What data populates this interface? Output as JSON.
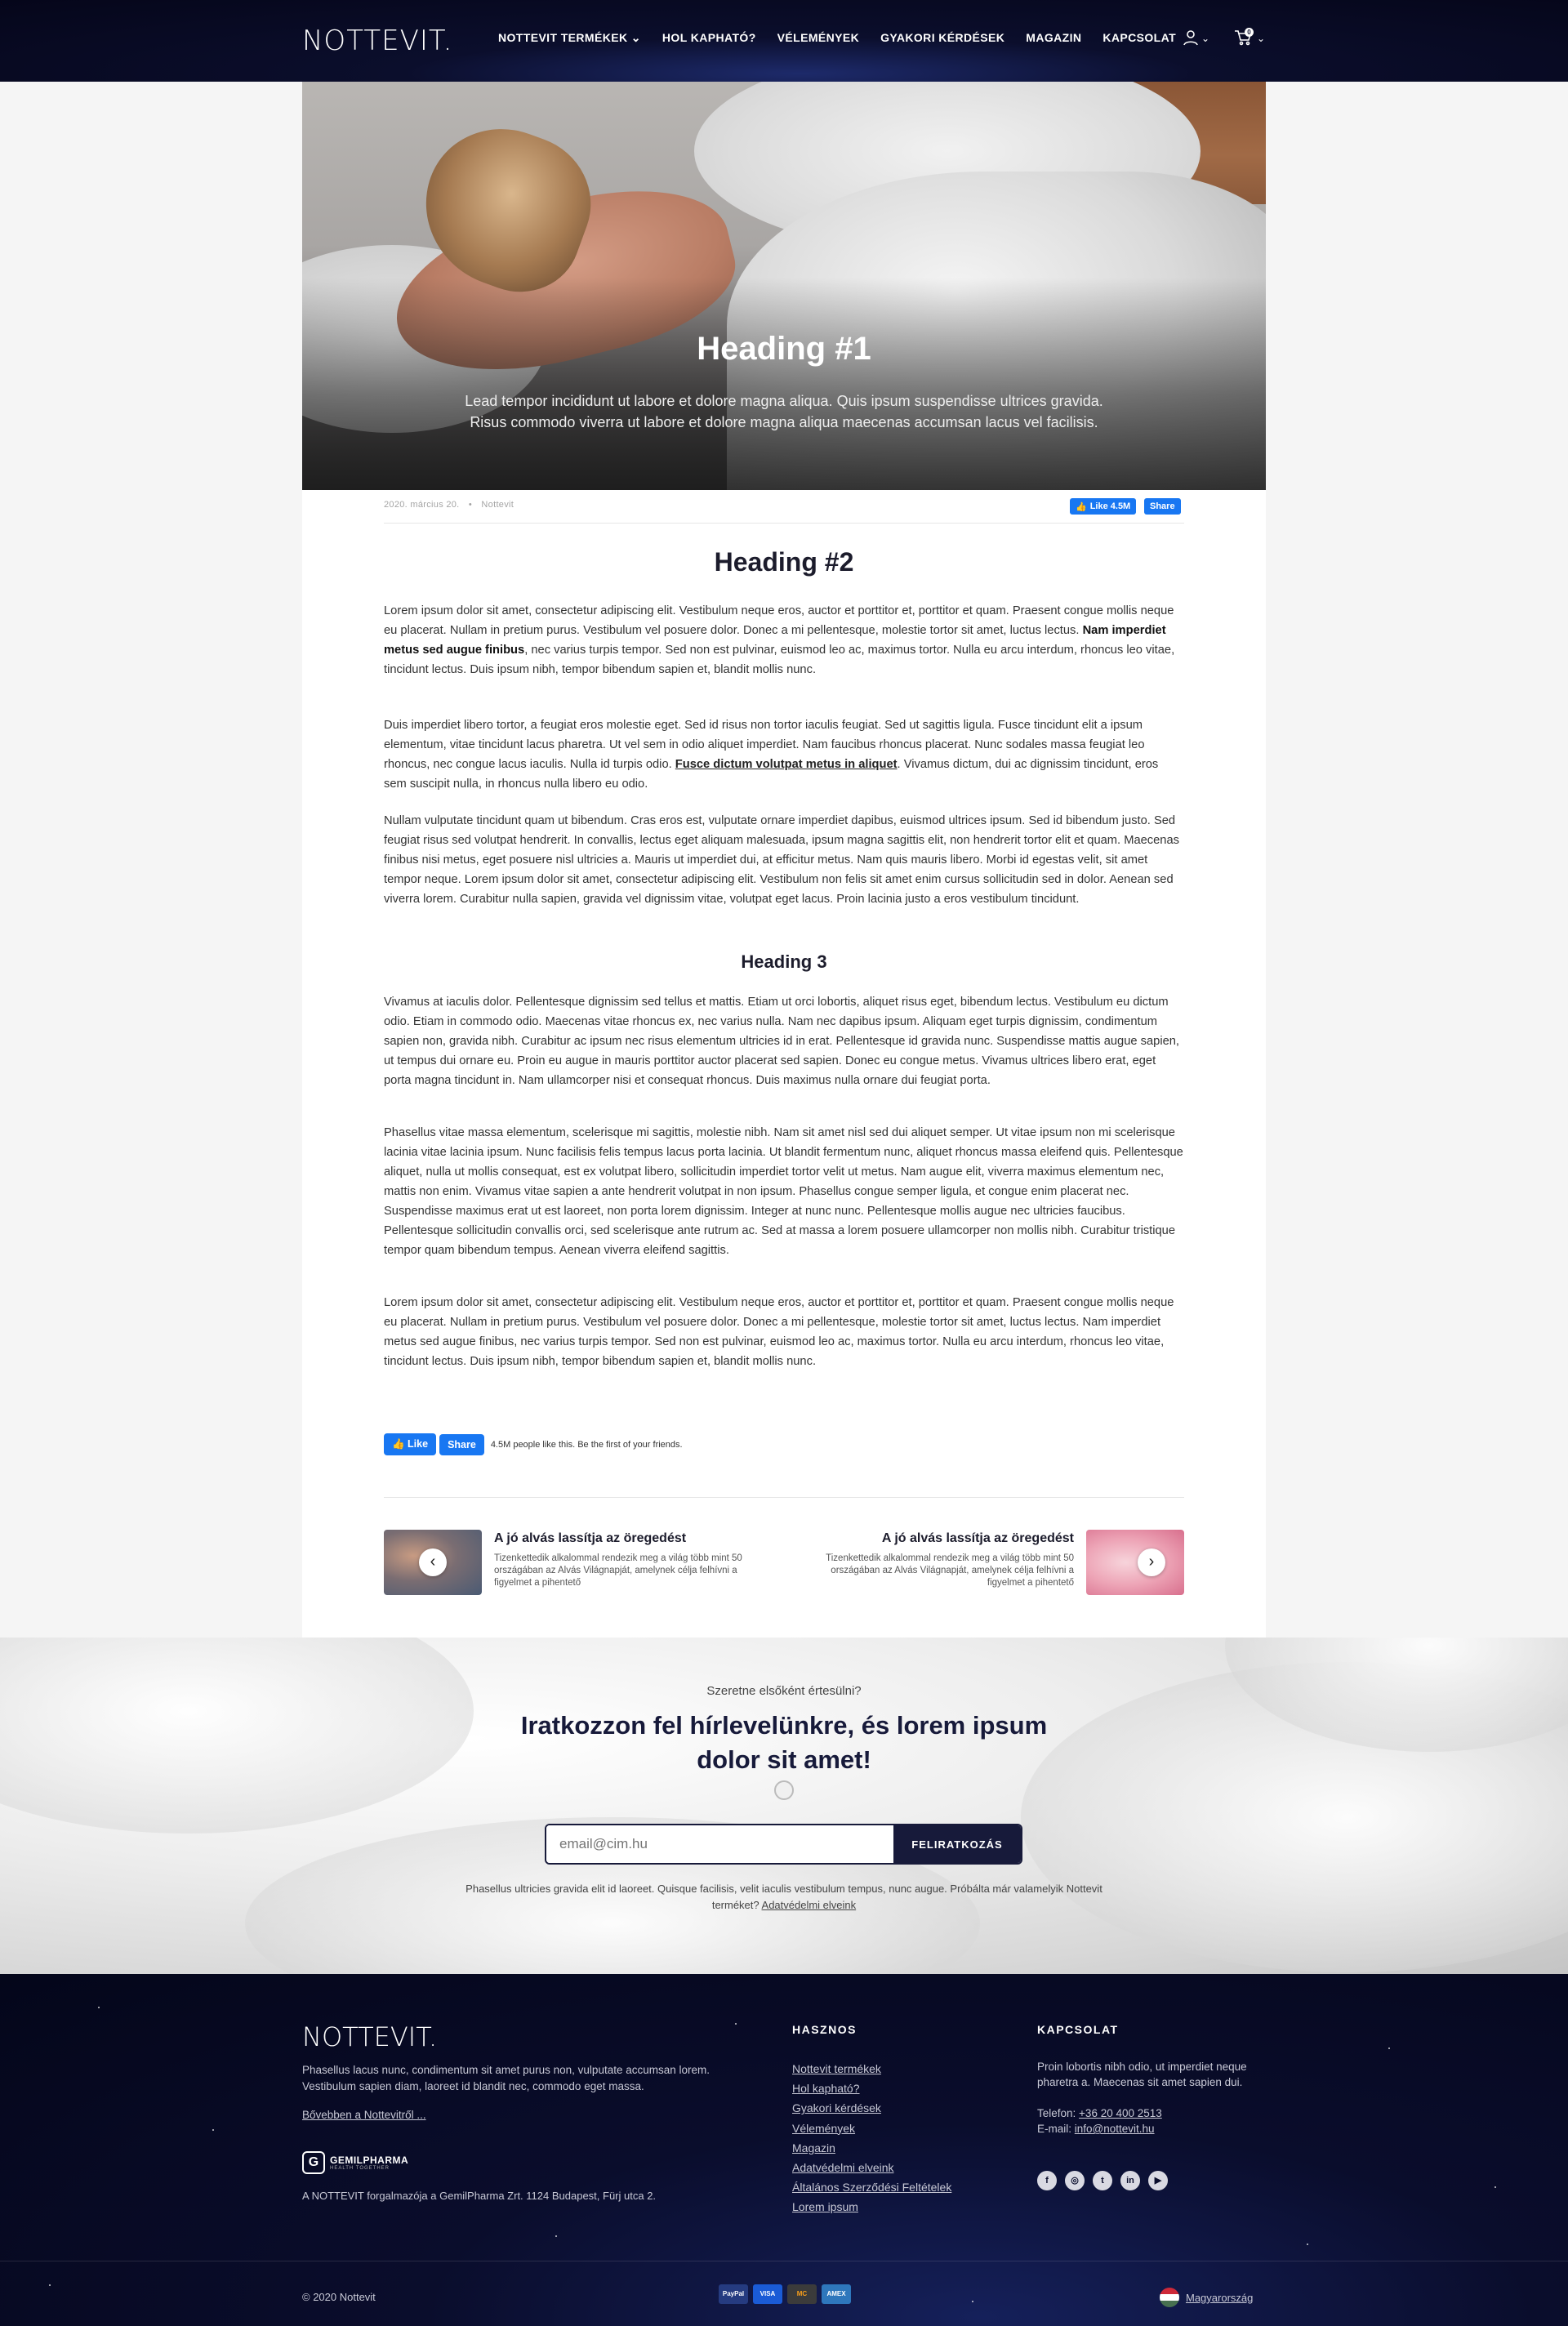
{
  "header": {
    "logo": "NOTTEVIT.",
    "nav": [
      "NOTTEVIT TERMÉKEK",
      "HOL KAPHATÓ?",
      "VÉLEMÉNYEK",
      "GYAKORI KÉRDÉSEK",
      "MAGAZIN",
      "KAPCSOLAT"
    ],
    "cart_count": "0",
    "icons": [
      "chevron-down-icon",
      "user-icon",
      "cart-icon"
    ]
  },
  "hero": {
    "title": "Heading #1",
    "lead": "Lead tempor incididunt ut labore et dolore magna aliqua. Quis ipsum suspendisse ultrices gravida. Risus commodo viverra ut labore et dolore magna aliqua maecenas accumsan lacus vel facilisis."
  },
  "meta": {
    "date": "2020. március 20.",
    "separator": "•",
    "author": "Nottevit",
    "fb_like": "Like 4.5M",
    "fb_share": "Share"
  },
  "article": {
    "heading2": "Heading #2",
    "p1_a": "Lorem ipsum dolor sit amet, consectetur adipiscing elit. Vestibulum neque eros, auctor et porttitor et, porttitor et quam. Praesent congue mollis neque eu placerat. Nullam in pretium purus. Vestibulum vel posuere dolor. Donec a mi pellentesque, molestie tortor sit amet, luctus lectus. ",
    "p1_bold": "Nam imperdiet metus sed augue finibus",
    "p1_b": ", nec varius turpis tempor. Sed non est pulvinar, euismod leo ac, maximus tortor. Nulla eu arcu interdum, rhoncus leo vitae, tincidunt lectus. Duis ipsum nibh, tempor bibendum sapien et, blandit mollis nunc.",
    "p2_a": "Duis imperdiet libero tortor, a feugiat eros molestie eget. Sed id risus non tortor iaculis feugiat. Sed ut sagittis ligula. Fusce tincidunt elit a ipsum elementum, vitae tincidunt lacus pharetra. Ut vel sem in odio aliquet imperdiet. Nam faucibus rhoncus placerat. Nunc sodales massa feugiat leo rhoncus, nec congue lacus iaculis. Nulla id turpis odio. ",
    "p2_link": "Fusce dictum volutpat metus in aliquet",
    "p2_b": ". Vivamus dictum, dui ac dignissim tincidunt, eros sem suscipit nulla, in rhoncus nulla libero eu odio.",
    "p3": "Nullam vulputate tincidunt quam ut bibendum. Cras eros est, vulputate ornare imperdiet dapibus, euismod ultrices ipsum. Sed id bibendum justo. Sed feugiat risus sed volutpat hendrerit. In convallis, lectus eget aliquam malesuada, ipsum magna sagittis elit, non hendrerit tortor elit et quam. Maecenas finibus nisi metus, eget posuere nisl ultricies a. Mauris ut imperdiet dui, at efficitur metus. Nam quis mauris libero. Morbi id egestas velit, sit amet tempor neque. Lorem ipsum dolor sit amet, consectetur adipiscing elit. Vestibulum non felis sit amet enim cursus sollicitudin sed in dolor. Aenean sed viverra lorem. Curabitur nulla sapien, gravida vel dignissim vitae, volutpat eget lacus. Proin lacinia justo a eros vestibulum tincidunt.",
    "heading3": "Heading 3",
    "p4": "Vivamus at iaculis dolor. Pellentesque dignissim sed tellus et mattis. Etiam ut orci lobortis, aliquet risus eget, bibendum lectus. Vestibulum eu dictum odio. Etiam in commodo odio. Maecenas vitae rhoncus ex, nec varius nulla. Nam nec dapibus ipsum. Aliquam eget turpis dignissim, condimentum sapien non, gravida nibh. Curabitur ac ipsum nec risus elementum ultricies id in erat. Pellentesque id gravida nunc. Suspendisse mattis augue sapien, ut tempus dui ornare eu. Proin eu augue in mauris porttitor auctor placerat sed sapien. Donec eu congue metus. Vivamus ultrices libero erat, eget porta magna tincidunt in. Nam ullamcorper nisi et consequat rhoncus. Duis maximus nulla ornare dui feugiat porta.",
    "p5": "Phasellus vitae massa elementum, scelerisque mi sagittis, molestie nibh. Nam sit amet nisl sed dui aliquet semper. Ut vitae ipsum non mi scelerisque lacinia vitae lacinia ipsum. Nunc facilisis felis tempus lacus porta lacinia. Ut blandit fermentum nunc, aliquet rhoncus massa eleifend quis. Pellentesque aliquet, nulla ut mollis consequat, est ex volutpat libero, sollicitudin imperdiet tortor velit ut metus. Nam augue elit, viverra maximus elementum nec, mattis non enim. Vivamus vitae sapien a ante hendrerit volutpat in non ipsum. Phasellus congue semper ligula, et congue enim placerat nec. Suspendisse maximus erat ut est laoreet, non porta lorem dignissim. Integer at nunc nunc. Pellentesque mollis augue nec ultricies faucibus. Pellentesque sollicitudin convallis orci, sed scelerisque ante rutrum ac. Sed at massa a lorem posuere ullamcorper non mollis nibh. Curabitur tristique tempor quam bibendum tempus. Aenean viverra eleifend sagittis.",
    "p6": "Lorem ipsum dolor sit amet, consectetur adipiscing elit. Vestibulum neque eros, auctor et porttitor et, porttitor et quam. Praesent congue mollis neque eu placerat. Nullam in pretium purus. Vestibulum vel posuere dolor. Donec a mi pellentesque, molestie tortor sit amet, luctus lectus. Nam imperdiet metus sed augue finibus, nec varius turpis tempor. Sed non est pulvinar, euismod leo ac, maximus tortor. Nulla eu arcu interdum, rhoncus leo vitae, tincidunt lectus. Duis ipsum nibh, tempor bibendum sapien et, blandit mollis nunc."
  },
  "facebook": {
    "like": "Like",
    "share": "Share",
    "text": "4.5M people like this. Be the first of your friends."
  },
  "related": {
    "prev": {
      "title": "A jó alvás lassítja az öregedést",
      "desc": "Tizenkettedik alkalommal rendezik meg a világ több mint 50 országában az Alvás Világnapját, amelynek célja felhívni a figyelmet a pihentető"
    },
    "next": {
      "title": "A jó alvás lassítja az öregedést",
      "desc": "Tizenkettedik alkalommal rendezik meg a világ több mint 50 országában az Alvás Világnapját, amelynek célja felhívni a figyelmet a pihentető"
    }
  },
  "newsletter": {
    "subtitle": "Szeretne elsőként értesülni?",
    "title": "Iratkozzon fel hírlevelünkre, és lorem ipsum dolor sit amet!",
    "placeholder": "email@cim.hu",
    "button": "FELIRATKOZÁS",
    "note": "Phasellus ultricies gravida elit id laoreet. Quisque facilisis, velit iaculis vestibulum tempus, nunc augue. Próbálta már valamelyik Nottevit terméket? ",
    "note_link": "Adatvédelmi elveink"
  },
  "footer": {
    "logo": "NOTTEVIT.",
    "description": "Phasellus lacus nunc, condimentum sit amet purus non, vulputate accumsan lorem. Vestibulum sapien diam, laoreet id blandit nec, commodo eget massa.",
    "more_link": "Bővebben a Nottevitről ...",
    "gemil_mark": "G",
    "gemil_name": "GEMILPHARMA",
    "gemil_tagline": "HEALTH TOGETHER",
    "legal": "A NOTTEVIT forgalmazója a GemilPharma Zrt. 1124 Budapest, Fürj utca 2.",
    "useful_title": "HASZNOS",
    "useful_links": [
      "Nottevit termékek",
      "Hol kapható?",
      "Gyakori kérdések",
      "Vélemények",
      "Magazin",
      "Adatvédelmi elveink",
      "Általános Szerződési Feltételek",
      "Lorem ipsum"
    ],
    "contact_title": "KAPCSOLAT",
    "contact_text": "Proin lobortis nibh odio, ut imperdiet neque pharetra a. Maecenas sit amet sapien dui.",
    "phone_label": "Telefon: ",
    "phone": "+36 20 400 2513",
    "email_label": "E-mail: ",
    "email": "info@nottevit.hu",
    "social_icons": [
      "facebook-icon",
      "instagram-icon",
      "twitter-icon",
      "linkedin-icon",
      "youtube-icon"
    ],
    "copyright": "© 2020 Nottevit",
    "payments": [
      "PayPal",
      "VISA",
      "MC",
      "AMEX"
    ],
    "country": "Magyarország"
  }
}
